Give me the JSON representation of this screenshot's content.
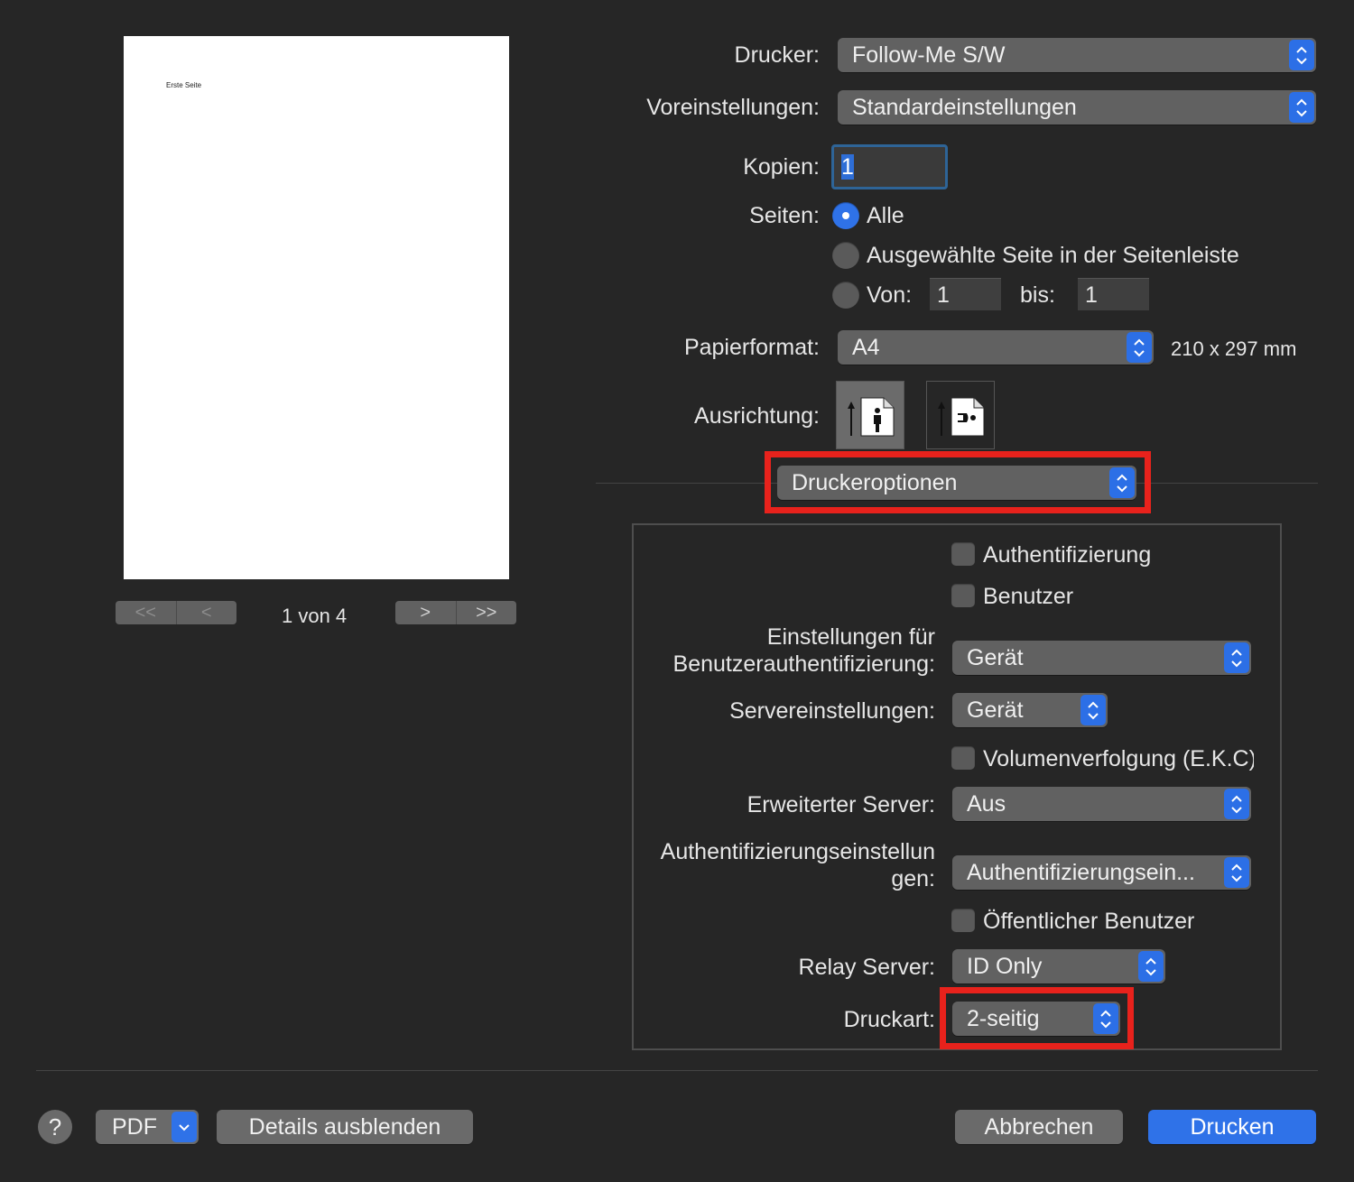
{
  "preview": {
    "page_text": "Erste Seite",
    "page_indicator": "1 von 4",
    "nav": {
      "first": "<<",
      "prev": "<",
      "next": ">",
      "last": ">>"
    }
  },
  "form": {
    "printer_label": "Drucker:",
    "printer_value": "Follow-Me S/W",
    "presets_label": "Voreinstellungen:",
    "presets_value": "Standardeinstellungen",
    "copies_label": "Kopien:",
    "copies_value": "1",
    "pages_label": "Seiten:",
    "pages_all": "Alle",
    "pages_selected": "Ausgewählte Seite in der Seitenleiste",
    "pages_from_label": "Von:",
    "pages_from_value": "1",
    "pages_to_label": "bis:",
    "pages_to_value": "1",
    "paper_label": "Papierformat:",
    "paper_value": "A4",
    "paper_size": "210 x 297 mm",
    "orientation_label": "Ausrichtung:"
  },
  "section_popup": "Druckeroptionen",
  "options": {
    "auth_check": "Authentifizierung",
    "user_check": "Benutzer",
    "user_auth_label_1": "Einstellungen für",
    "user_auth_label_2": "Benutzerauthentifizierung:",
    "user_auth_value": "Gerät",
    "server_label": "Servereinstellungen:",
    "server_value": "Gerät",
    "volume_check": "Volumenverfolgung (E.K.C)",
    "ext_server_label": "Erweiterter Server:",
    "ext_server_value": "Aus",
    "auth_settings_label_1": "Authentifizierungseinstellun",
    "auth_settings_label_2": "gen:",
    "auth_settings_value": "Authentifizierungsein...",
    "public_user_check": "Öffentlicher Benutzer",
    "relay_label": "Relay Server:",
    "relay_value": "ID Only",
    "print_type_label": "Druckart:",
    "print_type_value": "2-seitig"
  },
  "footer": {
    "help": "?",
    "pdf": "PDF",
    "hide_details": "Details ausblenden",
    "cancel": "Abbrechen",
    "print": "Drucken"
  },
  "colors": {
    "accent": "#2f72e8",
    "highlight": "#e8221c",
    "background": "#262626"
  }
}
